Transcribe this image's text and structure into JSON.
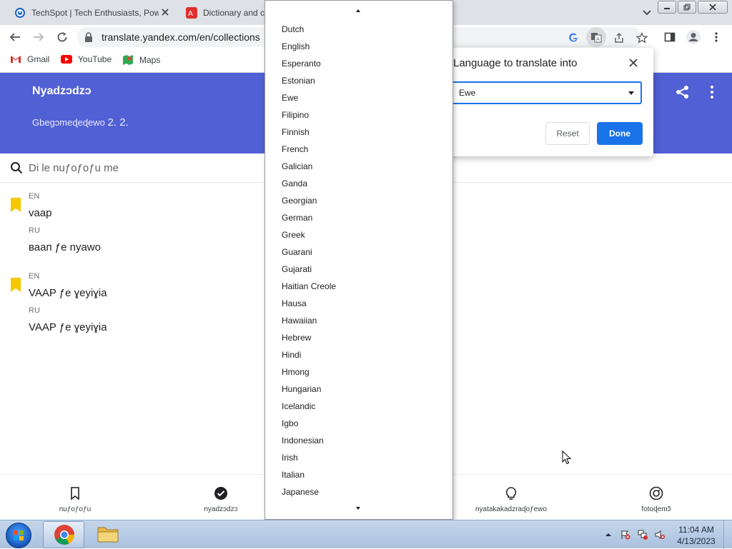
{
  "browser": {
    "tabs": [
      {
        "title": "TechSpot | Tech Enthusiasts, Power Users, IT Professionals and Gamers",
        "active": false,
        "favicon": "techspot-icon"
      },
      {
        "title": "Dictionary and c",
        "active": true,
        "favicon": "yandex-translate-icon"
      }
    ],
    "url": "translate.yandex.com/en/collections",
    "bookmarks": [
      {
        "label": "Gmail",
        "icon": "gmail-icon"
      },
      {
        "label": "YouTube",
        "icon": "youtube-icon"
      },
      {
        "label": "Maps",
        "icon": "maps-icon"
      }
    ]
  },
  "page": {
    "header": {
      "title": "Nyadzɔdzɔ",
      "subtitle": "Gbegɔmeɖeɖewo",
      "count": "2. 2.",
      "color": "#5160d4"
    },
    "search_placeholder": "Di le nuƒoƒoƒu me",
    "entries": [
      {
        "src_lang": "EN",
        "src_text": "vaap",
        "dst_lang": "RU",
        "dst_text": "ваап ƒe nyawo"
      },
      {
        "src_lang": "EN",
        "src_text": "VAAP ƒe ɣeyiɣia",
        "dst_lang": "RU",
        "dst_text": "VAAP ƒe ɣeyiɣia"
      }
    ],
    "bottom_nav": [
      {
        "label": "nuƒoƒoƒu",
        "icon": "bookmark-icon"
      },
      {
        "label": "nyadzɔdzɔ",
        "icon": "check-circle-icon"
      },
      {
        "label": "nyatakakadzraɖoƒewo",
        "icon": "lightbulb-icon"
      },
      {
        "label": "fotoɖemɔ̃",
        "icon": "camera-icon"
      }
    ]
  },
  "translate_popup": {
    "title": "Language to translate into",
    "selected": "Ewe",
    "reset_label": "Reset",
    "done_label": "Done",
    "accent": "#1a73e8"
  },
  "language_dropdown": {
    "items": [
      "Dutch",
      "English",
      "Esperanto",
      "Estonian",
      "Ewe",
      "Filipino",
      "Finnish",
      "French",
      "Galician",
      "Ganda",
      "Georgian",
      "German",
      "Greek",
      "Guarani",
      "Gujarati",
      "Haitian Creole",
      "Hausa",
      "Hawaiian",
      "Hebrew",
      "Hindi",
      "Hmong",
      "Hungarian",
      "Icelandic",
      "Igbo",
      "Indonesian",
      "Irish",
      "Italian",
      "Japanese"
    ]
  },
  "taskbar": {
    "time": "11:04 AM",
    "date": "4/13/2023"
  }
}
